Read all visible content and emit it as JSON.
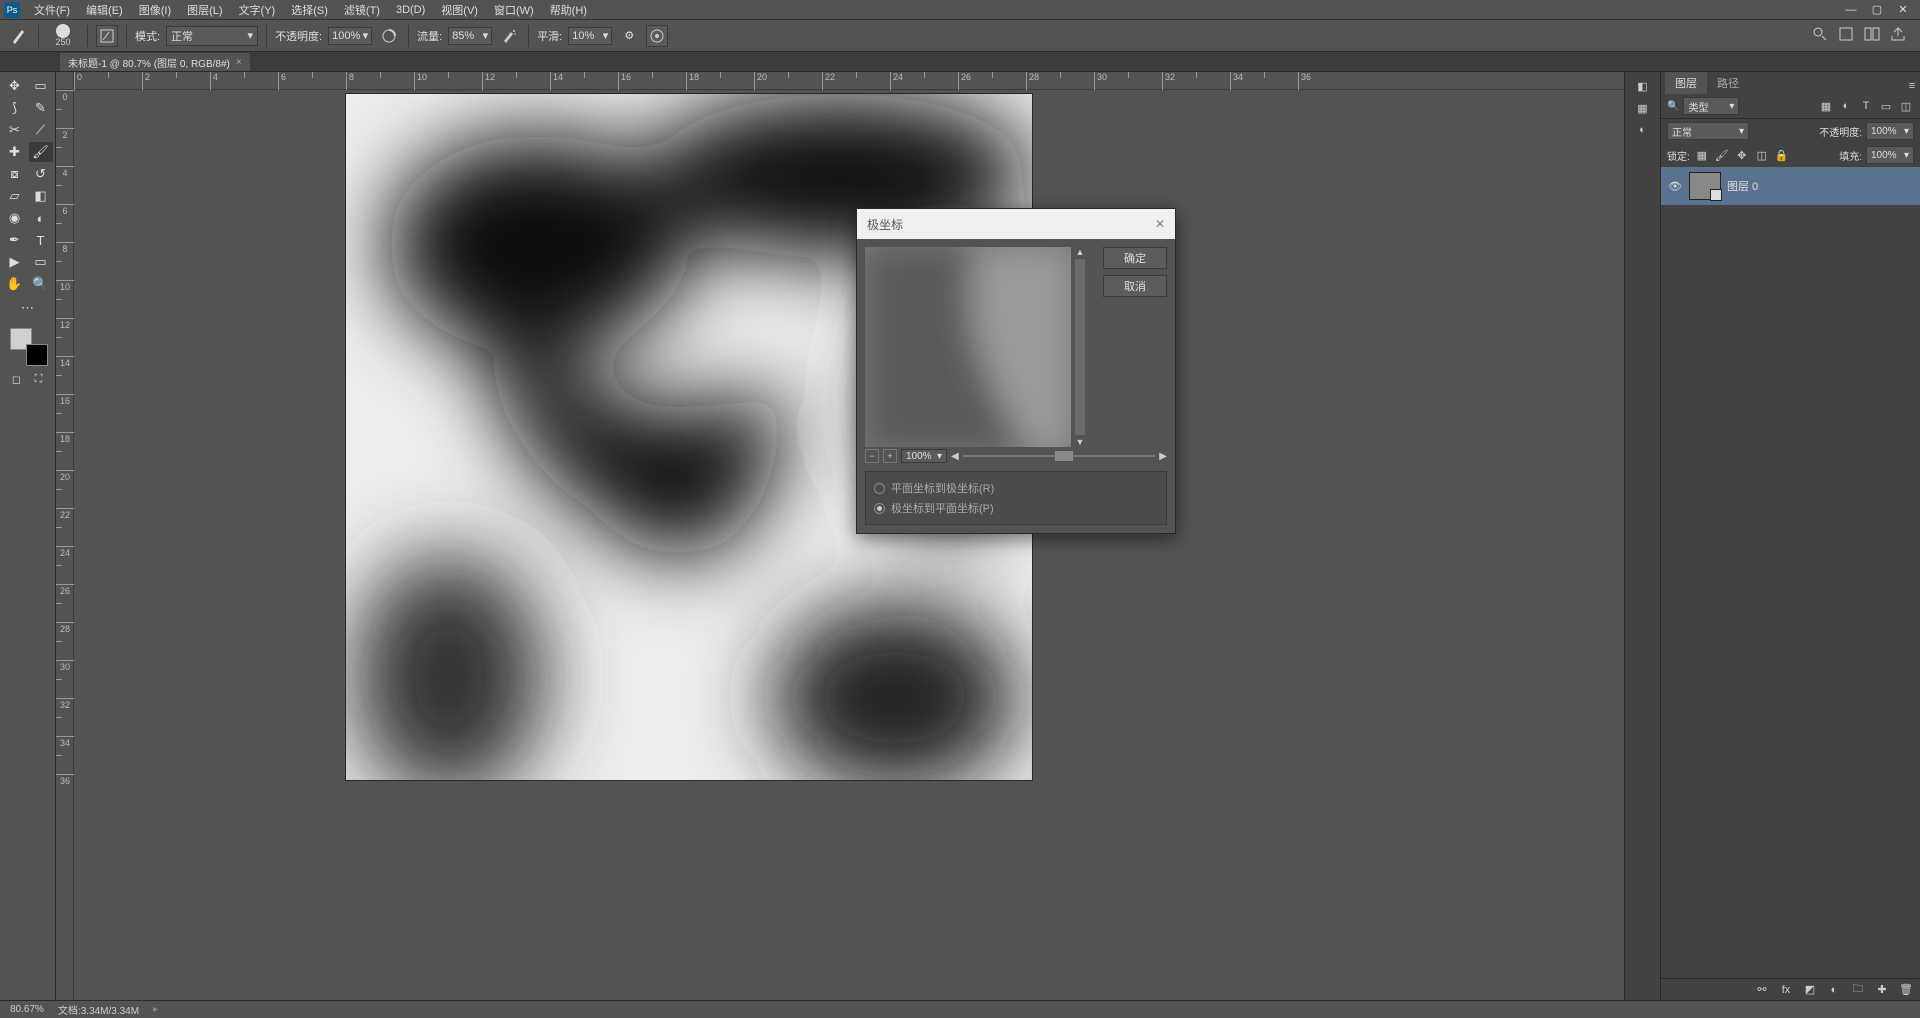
{
  "menu": {
    "items": [
      "文件(F)",
      "编辑(E)",
      "图像(I)",
      "图层(L)",
      "文字(Y)",
      "选择(S)",
      "滤镜(T)",
      "3D(D)",
      "视图(V)",
      "窗口(W)",
      "帮助(H)"
    ]
  },
  "optbar": {
    "brush_size": "250",
    "mode_label": "模式:",
    "mode_value": "正常",
    "opacity_label": "不透明度:",
    "opacity_value": "100%",
    "flow_label": "流量:",
    "flow_value": "85%",
    "smooth_label": "平滑:",
    "smooth_value": "10%"
  },
  "doc_tab": {
    "title": "未标题-1 @ 80.7% (图层 0, RGB/8#)"
  },
  "ruler": {
    "h": [
      "0",
      ".",
      "2",
      ".",
      "4",
      ".",
      "6",
      ".",
      "8",
      ".",
      "10",
      ".",
      "12",
      ".",
      "14",
      ".",
      "16",
      ".",
      "18",
      ".",
      "20",
      ".",
      "22",
      ".",
      "24",
      ".",
      "26",
      ".",
      "28",
      ".",
      "30",
      ".",
      "32",
      ".",
      "34",
      ".",
      "36"
    ],
    "v": [
      "0",
      ".",
      "2",
      ".",
      "4",
      ".",
      "6",
      ".",
      "8",
      ".",
      "10",
      ".",
      "12",
      ".",
      "14",
      ".",
      "16",
      ".",
      "18",
      ".",
      "20",
      ".",
      "22",
      ".",
      "24",
      ".",
      "26",
      ".",
      "28",
      ".",
      "30",
      ".",
      "32",
      ".",
      "34",
      ".",
      "36"
    ]
  },
  "dialog": {
    "title": "极坐标",
    "ok": "确定",
    "cancel": "取消",
    "zoom": "100%",
    "option1": "平面坐标到极坐标(R)",
    "option2": "极坐标到平面坐标(P)"
  },
  "layers_panel": {
    "tab1": "图层",
    "tab2": "路径",
    "kind_label": "类型",
    "blend": "正常",
    "opacity_label": "不透明度:",
    "opacity_value": "100%",
    "lock_label": "锁定:",
    "fill_label": "填充:",
    "fill_value": "100%",
    "layer0": "图层 0"
  },
  "status": {
    "zoom": "80.67%",
    "doc": "文档:3.34M/3.34M"
  }
}
